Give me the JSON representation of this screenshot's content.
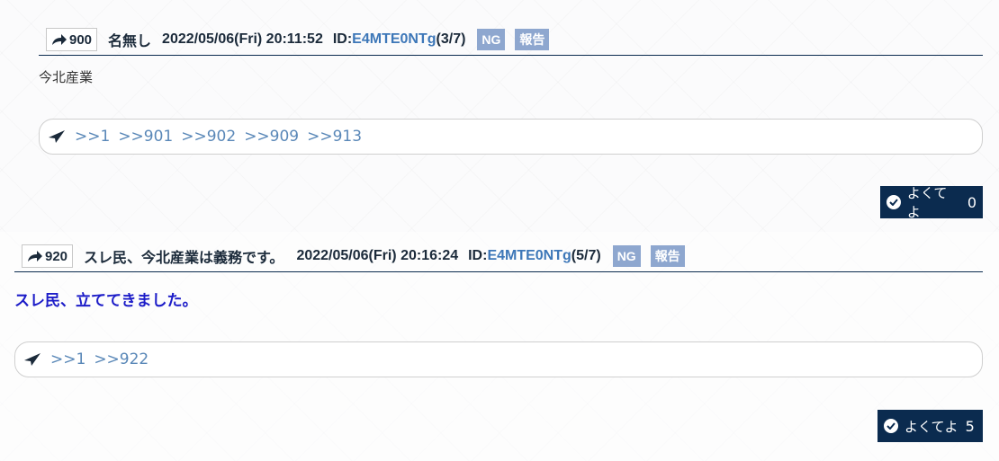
{
  "posts": [
    {
      "number": "900",
      "name": "名無し",
      "datetime": "2022/05/06(Fri) 20:11:52",
      "id_prefix": "ID:",
      "id_value": "E4MTE0NTg",
      "id_count": "(3/7)",
      "ng_label": "NG",
      "report_label": "報告",
      "body": "今北産業",
      "replies": [
        ">>1",
        ">>901",
        ">>902",
        ">>909",
        ">>913"
      ],
      "like_label": "よくてよ",
      "like_count": "0"
    },
    {
      "number": "920",
      "name": "スレ民、今北産業は義務です。",
      "datetime": "2022/05/06(Fri) 20:16:24",
      "id_prefix": "ID:",
      "id_value": "E4MTE0NTg",
      "id_count": "(5/7)",
      "ng_label": "NG",
      "report_label": "報告",
      "body": "スレ民、立ててきました。",
      "replies": [
        ">>1",
        ">>922"
      ],
      "like_label": "よくてよ",
      "like_count": "5"
    }
  ]
}
